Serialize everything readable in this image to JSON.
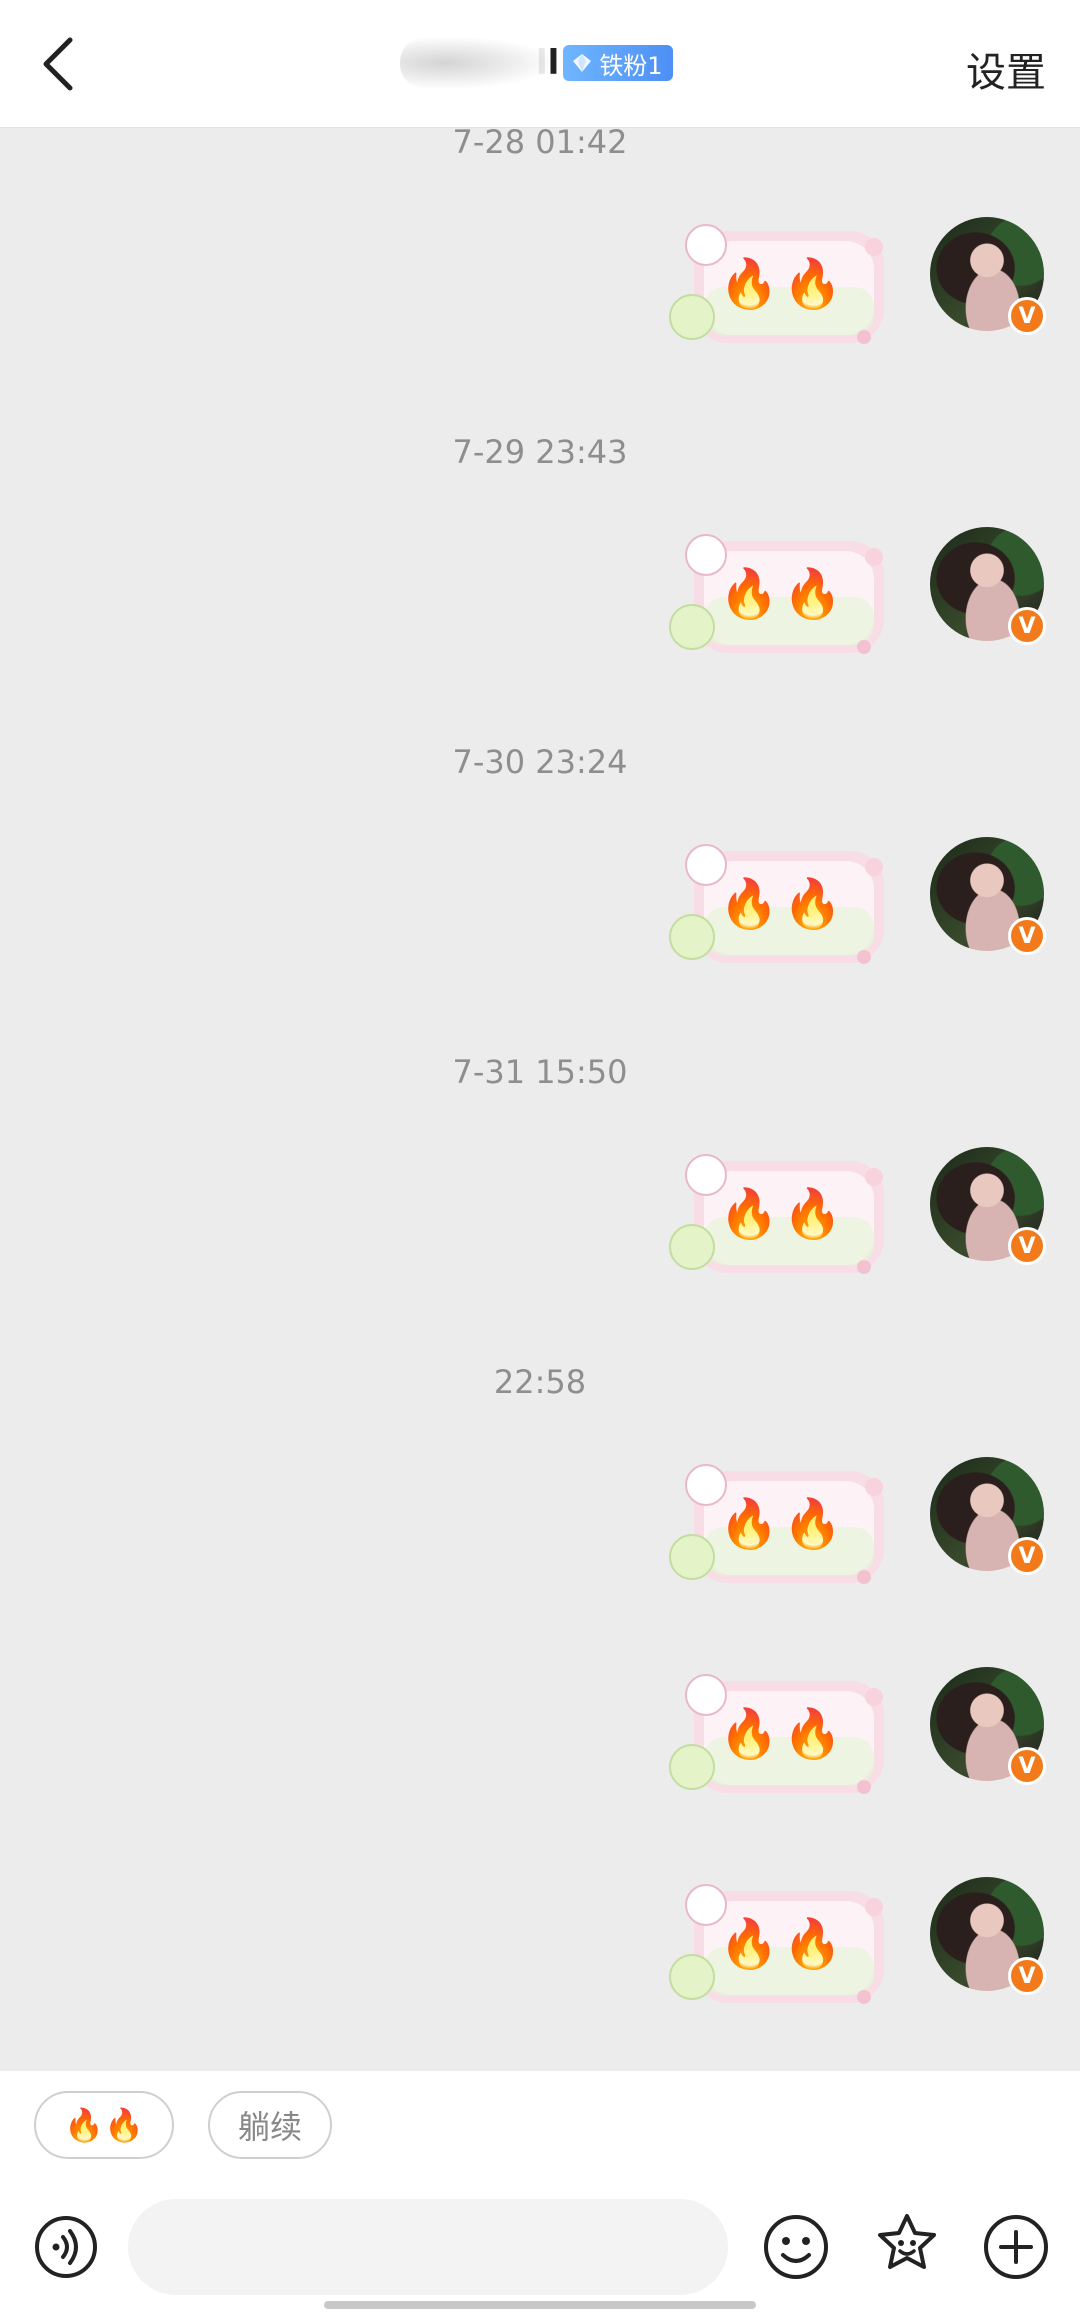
{
  "header": {
    "title_suffix": "ll",
    "fan_badge": "铁粉1",
    "settings_label": "设置",
    "badge_color": "#4d8ff5"
  },
  "messages": {
    "timestamps": [
      "7-28 01:42",
      "7-29 23:43",
      "7-30 23:24",
      "7-31 15:50",
      "22:58"
    ],
    "fire_emoji": "🔥",
    "verified_mark": "V",
    "verified_color": "#f27a1a"
  },
  "quick_replies": [
    {
      "label": "🔥🔥"
    },
    {
      "label": "躺续"
    }
  ],
  "composer": {
    "placeholder": "",
    "icons": [
      "voice-icon",
      "emoji-icon",
      "sticker-icon",
      "plus-icon"
    ]
  },
  "theme": {
    "chat_background": "#ececec",
    "timestamp_color": "#8e8e8e"
  }
}
